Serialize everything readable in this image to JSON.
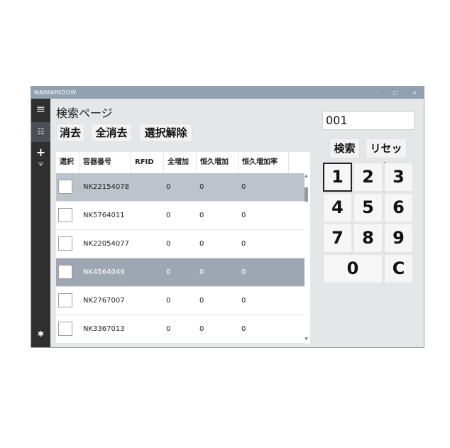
{
  "window": {
    "title": "MAINWINDOW",
    "min": "–",
    "max": "□",
    "close": "×"
  },
  "sidebar": {
    "menu_icon": "≡",
    "list_icon": "☷",
    "add_icon": "+",
    "wifi_icon": "ᯤ",
    "settings_icon": "✱"
  },
  "page": {
    "title": "検索ページ"
  },
  "toolbar": {
    "delete": "消去",
    "delete_all": "全消去",
    "deselect": "選択解除"
  },
  "table": {
    "headers": [
      "選択",
      "容器番号",
      "RFID",
      "全増加",
      "恒久増加",
      "恒久増加率"
    ],
    "rows": [
      {
        "container": "NK22154078",
        "rfid": "",
        "total": "0",
        "perm": "0",
        "rate": "0",
        "selected": true
      },
      {
        "container": "NK5764011",
        "rfid": "",
        "total": "0",
        "perm": "0",
        "rate": "0",
        "selected": false
      },
      {
        "container": "NK22054077",
        "rfid": "",
        "total": "0",
        "perm": "0",
        "rate": "0",
        "selected": false
      },
      {
        "container": "NK4564049",
        "rfid": "",
        "total": "0",
        "perm": "0",
        "rate": "0",
        "selected": true
      },
      {
        "container": "NK2767007",
        "rfid": "",
        "total": "0",
        "perm": "0",
        "rate": "0",
        "selected": false
      },
      {
        "container": "NK3367013",
        "rfid": "",
        "total": "0",
        "perm": "0",
        "rate": "0",
        "selected": false
      }
    ]
  },
  "search": {
    "value": "001",
    "search_label": "検索",
    "reset_label": "リセット"
  },
  "keypad": [
    "1",
    "2",
    "3",
    "4",
    "5",
    "6",
    "7",
    "8",
    "9",
    "0",
    "C"
  ],
  "colors": {
    "titlebar": "#8fa0b0",
    "sidebar": "#2f2f2f",
    "row_selected_light": "#bcc3cb",
    "row_selected_dark": "#9ea7b1"
  }
}
